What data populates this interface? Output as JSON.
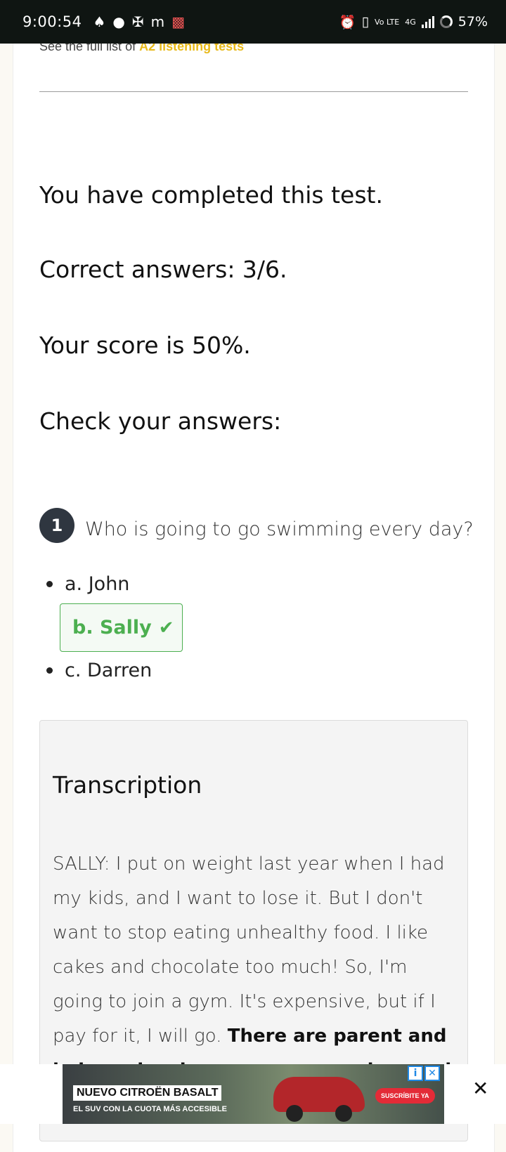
{
  "status_bar": {
    "time": "9:00:54",
    "left_icons": [
      "snapchat-icon",
      "chat-icon",
      "pinwheel-icon",
      "m-icon",
      "car-icon"
    ],
    "right_icons": [
      "alarm-icon",
      "vibrate-icon"
    ],
    "network_volte": "Vo LTE",
    "network_type": "4G",
    "battery": "57%"
  },
  "page": {
    "top_link_prefix": "See the full list of",
    "top_link_text": "A2 listening tests",
    "completed": "You have completed this test.",
    "correct": "Correct answers: 3/6.",
    "score": "Your score is 50%.",
    "check": "Check your answers:"
  },
  "question": {
    "number": "1",
    "text": "Who is going to go swimming every day?",
    "options": [
      {
        "label": "a. John",
        "correct": false
      },
      {
        "label": "b. Sally",
        "correct": true
      },
      {
        "label": "c. Darren",
        "correct": false
      }
    ]
  },
  "transcription": {
    "title": "Transcription",
    "body_plain": "SALLY: I put on weight last year when I had my kids, and I want to lose it. But I don't want to stop eating unhealthy food. I like cakes and chocolate too much! So, I'm going to join a gym. It's expensive, but if I pay for it, I will go.",
    "body_bold": "There are parent and baby swim classes every morning, and I"
  },
  "ad": {
    "headline": "NUEVO CITROËN BASALT",
    "subline": "EL SUV CON LA CUOTA MÁS ACCESIBLE",
    "cta": "SUSCRÍBITE YA",
    "info_icon": "i",
    "x_icon": "✕",
    "close": "✕"
  },
  "colors": {
    "accent_link": "#e8b91a",
    "correct_green": "#4caf50",
    "badge_dark": "#2f3640",
    "ad_cta_red": "#e32b37"
  }
}
